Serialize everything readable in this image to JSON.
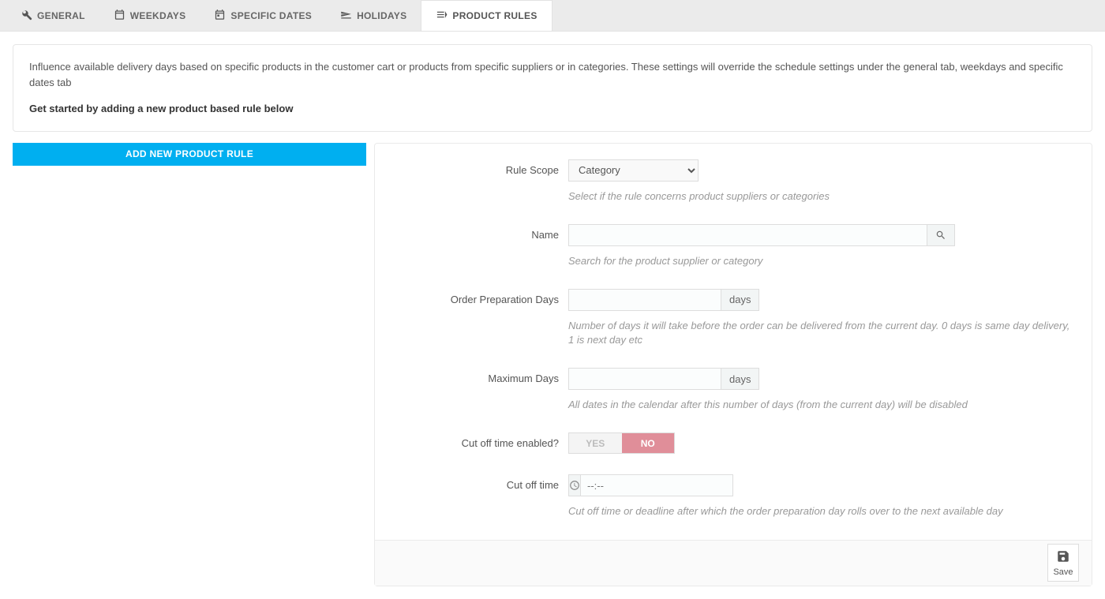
{
  "tabs": [
    {
      "label": "GENERAL"
    },
    {
      "label": "WEEKDAYS"
    },
    {
      "label": "SPECIFIC DATES"
    },
    {
      "label": "HOLIDAYS"
    },
    {
      "label": "PRODUCT RULES"
    }
  ],
  "info": {
    "desc": "Influence available delivery days based on specific products in the customer cart or products from specific suppliers or in categories. These settings will override the schedule settings under the general tab, weekdays and specific dates tab",
    "cta": "Get started by adding a new product based rule below"
  },
  "addBtn": "ADD NEW PRODUCT RULE",
  "form": {
    "ruleScope": {
      "label": "Rule Scope",
      "value": "Category",
      "help": "Select if the rule concerns product suppliers or categories"
    },
    "name": {
      "label": "Name",
      "help": "Search for the product supplier or category"
    },
    "prepDays": {
      "label": "Order Preparation Days",
      "addon": "days",
      "help": "Number of days it will take before the order can be delivered from the current day. 0 days is same day delivery, 1 is next day etc"
    },
    "maxDays": {
      "label": "Maximum Days",
      "addon": "days",
      "help": "All dates in the calendar after this number of days (from the current day) will be disabled"
    },
    "cutoffEnabled": {
      "label": "Cut off time enabled?",
      "yes": "YES",
      "no": "NO"
    },
    "cutoffTime": {
      "label": "Cut off time",
      "placeholder": "--:--",
      "help": "Cut off time or deadline after which the order preparation day rolls over to the next available day"
    },
    "save": "Save"
  }
}
